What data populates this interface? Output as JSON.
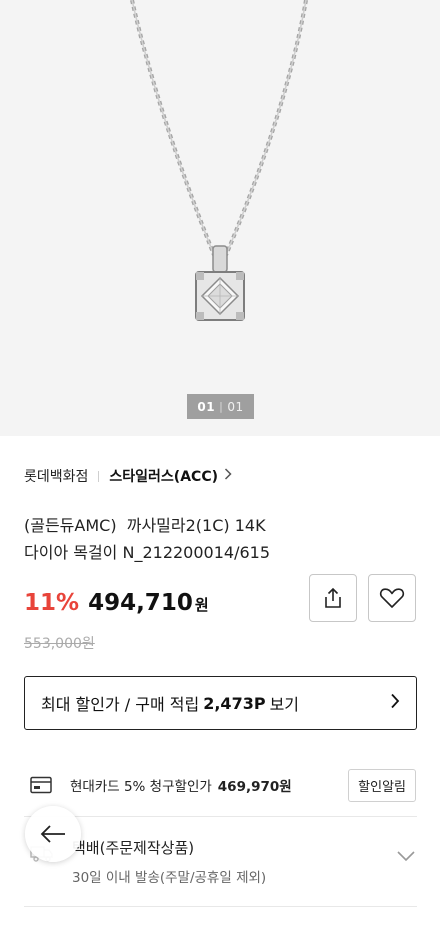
{
  "gallery": {
    "current": "01",
    "total": "01",
    "image_icon": "necklace-product-image"
  },
  "breadcrumb": {
    "store": "롯데백화점",
    "brand": "스타일러스(ACC)",
    "chevron_icon": "chevron-right-icon"
  },
  "product": {
    "title_line1": "(골든듀AMC)  까사밀라2(1C) 14K",
    "title_line2": "다이아 목걸이 N_212200014/615",
    "discount": "11%",
    "price": "494,710",
    "price_unit": "원",
    "original_price": "553,000원"
  },
  "actions": {
    "share_icon": "share-icon",
    "wishlist_icon": "heart-icon"
  },
  "promo": {
    "label_start": "최대 할인가 / 구매 적립",
    "points": "2,473P",
    "label_end": "보기",
    "arrow_icon": "chevron-right-icon"
  },
  "card_benefit": {
    "icon": "card-icon",
    "text": "현대카드 5% 청구할인가",
    "amount": "469,970원",
    "button": "할인알림"
  },
  "shipping": {
    "icon": "truck-icon",
    "title": "택배(주문제작상품)",
    "subtitle": "30일 이내 발송(주말/공휴일 제외)",
    "chevron_icon": "chevron-down-icon"
  },
  "back_button": {
    "icon": "arrow-left-icon"
  },
  "colors": {
    "discount": "#e8443a",
    "text": "#111111",
    "muted": "#aaaaaa",
    "hero_bg": "#f4f4f4"
  }
}
